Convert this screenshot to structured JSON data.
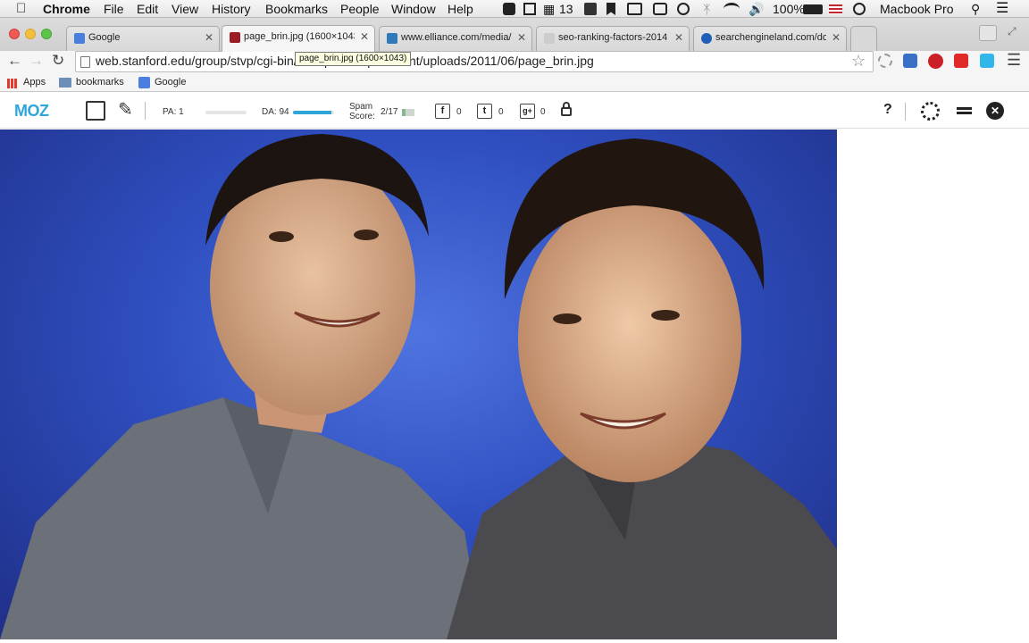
{
  "menubar": {
    "app_name": "Chrome",
    "menus": [
      "File",
      "Edit",
      "View",
      "History",
      "Bookmarks",
      "People",
      "Window",
      "Help"
    ],
    "status_date_number": "13",
    "battery": "100%",
    "user": "Macbook Pro"
  },
  "tabs": [
    {
      "label": "Google",
      "favicon_color": "#4a7fe0"
    },
    {
      "label": "page_brin.jpg (1600×1043)",
      "favicon_color": "#9b1c24"
    },
    {
      "label": "www.elliance.com/media/",
      "favicon_color": "#2f7ab8"
    },
    {
      "label": "seo-ranking-factors-2014",
      "favicon_color": "#cccccc"
    },
    {
      "label": "searchengineland.com/do",
      "favicon_color": "#1f5fb8"
    }
  ],
  "omnibox": {
    "url": "web.stanford.edu/group/stvp/cgi-bin/wordpress/wp-content/uploads/2011/06/page_brin.jpg"
  },
  "tooltip": "page_brin.jpg (1600×1043)",
  "bookmarks": {
    "apps": "Apps",
    "items": [
      "bookmarks",
      "Google"
    ]
  },
  "mozbar": {
    "logo": "MOZ",
    "pa_label": "PA: 1",
    "pa_fraction": 0.0,
    "da_label": "DA: 94",
    "da_fraction": 0.94,
    "spam_label_line1": "Spam",
    "spam_label_line2": "Score:",
    "spam_value": "2/17",
    "facebook_count": "0",
    "twitter_count": "0",
    "gplus_count": "0",
    "facebook_glyph": "f",
    "twitter_glyph": "t",
    "gplus_glyph": "g+",
    "help_glyph": "?"
  },
  "colors": {
    "moz_blue": "#2fa6d9",
    "photo_bg": "#3a5fd6"
  }
}
